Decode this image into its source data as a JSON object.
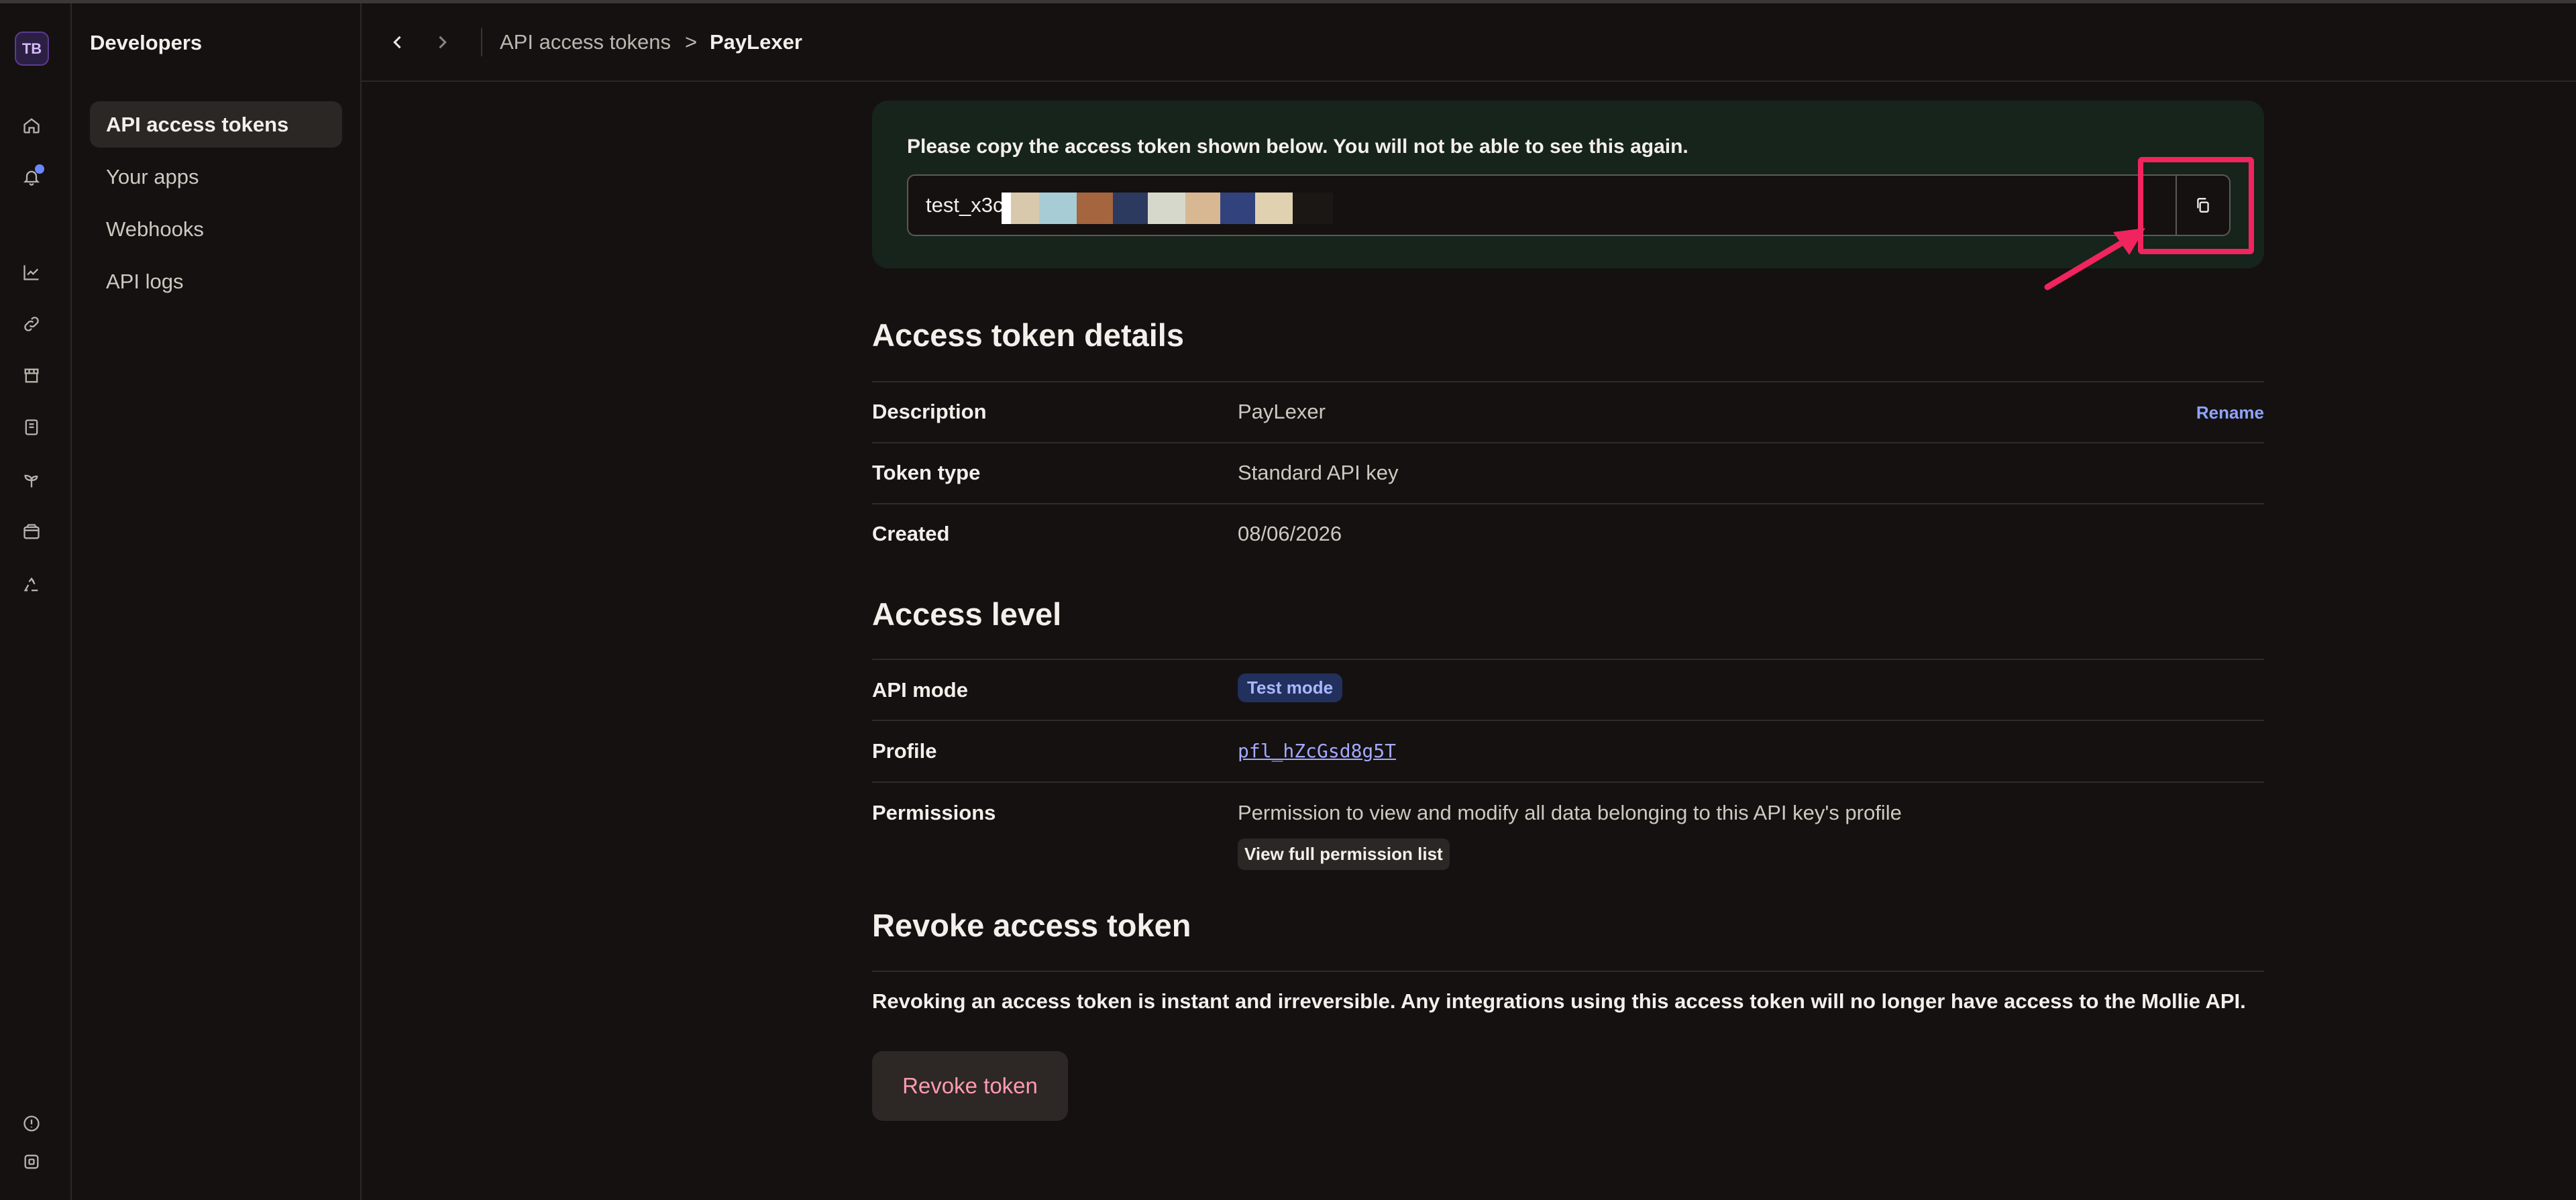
{
  "rail": {
    "avatar": "TB",
    "icons": [
      "home-icon",
      "bell-icon",
      "chart-icon",
      "link-icon",
      "store-icon",
      "document-icon",
      "sprout-icon",
      "wallet-icon",
      "recycle-icon",
      "help-icon",
      "terminal-icon"
    ]
  },
  "sidebar": {
    "title": "Developers",
    "items": [
      {
        "label": "API access tokens",
        "active": true
      },
      {
        "label": "Your apps",
        "active": false
      },
      {
        "label": "Webhooks",
        "active": false
      },
      {
        "label": "API logs",
        "active": false
      }
    ]
  },
  "topbar": {
    "breadcrumb": [
      "API access tokens",
      "PayLexer"
    ],
    "separator": ">"
  },
  "token": {
    "message": "Please copy the access token shown below. You will not be able to see this again.",
    "value_prefix": "test_x3c",
    "redaction_colors": [
      "#ffffff",
      "#d8c9ad",
      "#a7ccd6",
      "#a4653f",
      "#2d3a60",
      "#d7d8cc",
      "#d7b893",
      "#32427c",
      "#e0d1b1",
      "#1a1715"
    ]
  },
  "details": {
    "heading": "Access token details",
    "rows": [
      {
        "label": "Description",
        "value": "PayLexer",
        "action": "Rename"
      },
      {
        "label": "Token type",
        "value": "Standard API key"
      },
      {
        "label": "Created",
        "value": "08/06/2026"
      }
    ]
  },
  "access": {
    "heading": "Access level",
    "api_mode_label": "API mode",
    "api_mode_badge": "Test mode",
    "profile_label": "Profile",
    "profile_id": "pfl_hZcGsd8g5T",
    "permissions_label": "Permissions",
    "permissions_text": "Permission to view and modify all data belonging to this API key's profile",
    "permissions_button": "View full permission list"
  },
  "revoke": {
    "heading": "Revoke access token",
    "description": "Revoking an access token is instant and irreversible. Any integrations using this access token will no longer have access to the Mollie API.",
    "button": "Revoke token"
  },
  "colors": {
    "background": "#141110",
    "token_box": "#17241b",
    "highlight": "#f0245e",
    "accent": "#8fa3ff"
  }
}
